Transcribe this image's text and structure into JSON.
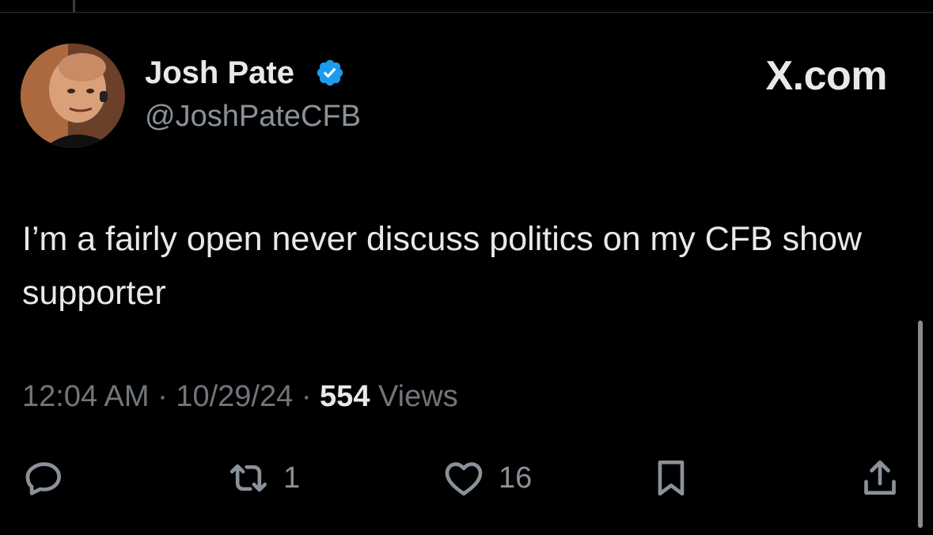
{
  "author": {
    "name": "Josh Pate",
    "handle": "@JoshPateCFB"
  },
  "brand": "X.com",
  "tweet": {
    "text": "I’m a fairly open never discuss politics on my CFB show supporter"
  },
  "meta": {
    "time": "12:04 AM",
    "separator": "·",
    "date": "10/29/24",
    "views_count": "554",
    "views_label": "Views"
  },
  "actions": {
    "retweets": "1",
    "likes": "16"
  },
  "colors": {
    "background": "#000000",
    "text": "#e7e9ea",
    "muted": "#71767b",
    "verified": "#1d9bf0"
  },
  "icons": [
    "reply-icon",
    "retweet-icon",
    "like-icon",
    "bookmark-icon",
    "share-icon",
    "verified-badge-icon"
  ]
}
